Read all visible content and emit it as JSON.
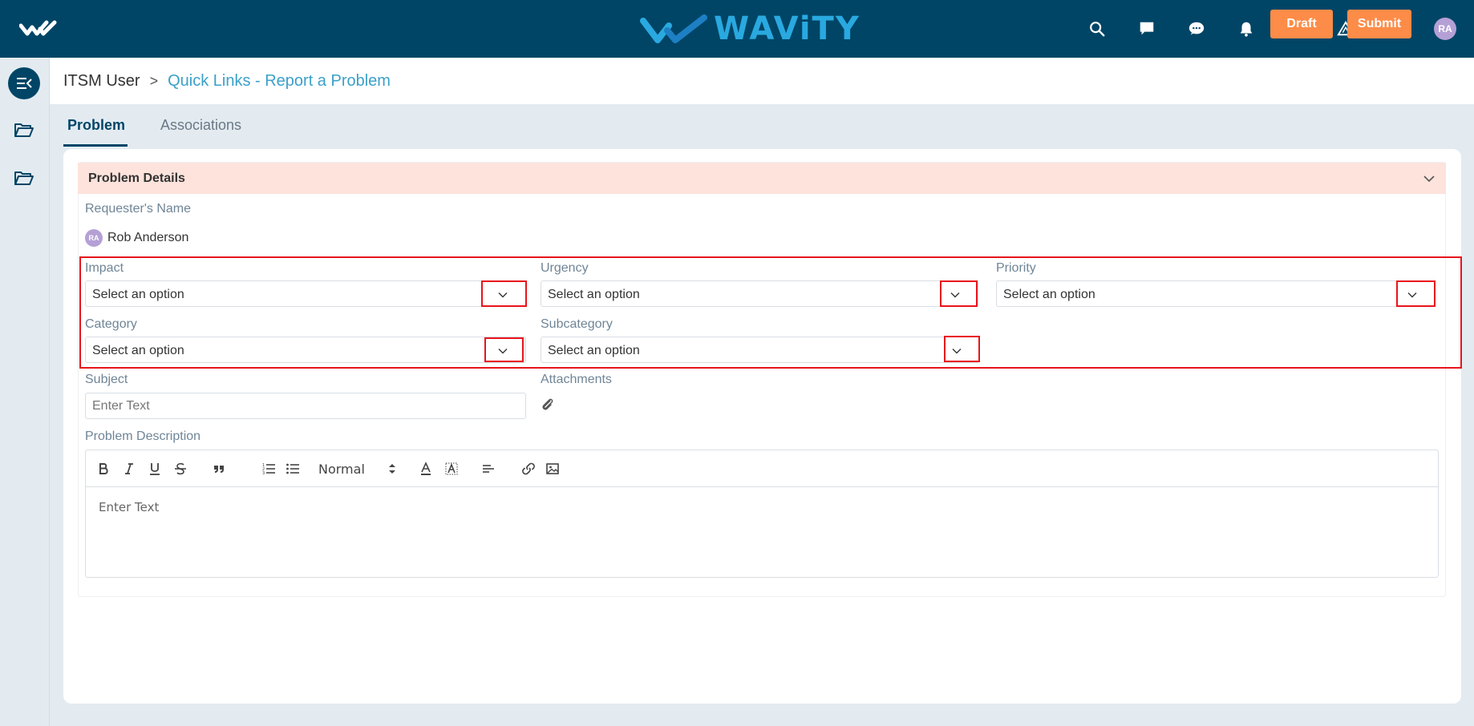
{
  "brand": {
    "name": "WAViTY"
  },
  "topbar": {
    "icons": [
      "search-icon",
      "message-icon",
      "chat-icon",
      "bell-icon",
      "book-icon",
      "alert-icon",
      "grid-icon"
    ],
    "avatar_initials": "RA"
  },
  "breadcrumb": {
    "root": "ITSM User",
    "separator": ">",
    "current": "Quick Links - Report a Problem"
  },
  "actions": {
    "draft_label": "Draft",
    "submit_label": "Submit"
  },
  "tabs": [
    {
      "label": "Problem",
      "active": true
    },
    {
      "label": "Associations",
      "active": false
    }
  ],
  "section": {
    "title": "Problem Details",
    "requester": {
      "label": "Requester's Name",
      "initials": "RA",
      "name": "Rob Anderson"
    },
    "fields": {
      "impact": {
        "label": "Impact",
        "value": "Select an option"
      },
      "urgency": {
        "label": "Urgency",
        "value": "Select an option"
      },
      "priority": {
        "label": "Priority",
        "value": "Select an option"
      },
      "category": {
        "label": "Category",
        "value": "Select an option"
      },
      "subcategory": {
        "label": "Subcategory",
        "value": "Select an option"
      },
      "subject": {
        "label": "Subject",
        "placeholder": "Enter Text"
      },
      "attachments": {
        "label": "Attachments"
      },
      "description": {
        "label": "Problem Description",
        "placeholder": "Enter Text",
        "format": "Normal"
      }
    }
  },
  "colors": {
    "topbar": "#004566",
    "accent": "#fd8c48",
    "brand": "#29a9e0",
    "highlight": "#e8141b",
    "section_header": "#fde3dc"
  }
}
